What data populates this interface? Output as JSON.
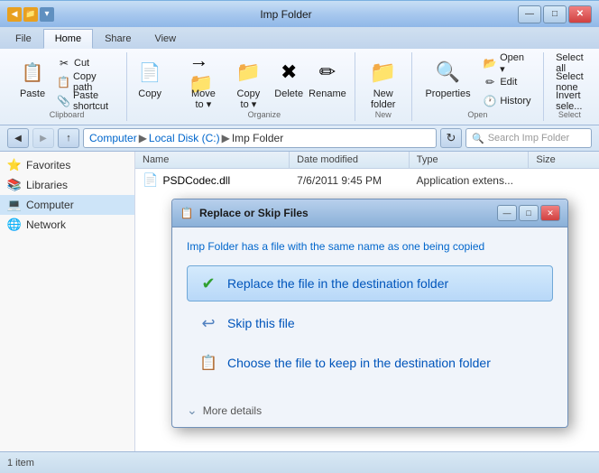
{
  "window": {
    "title": "Imp Folder",
    "controls": {
      "minimize": "—",
      "maximize": "□",
      "close": "✕"
    }
  },
  "ribbon": {
    "tabs": [
      {
        "label": "File",
        "active": false
      },
      {
        "label": "Home",
        "active": true
      },
      {
        "label": "Share",
        "active": false
      },
      {
        "label": "View",
        "active": false
      }
    ],
    "groups": {
      "clipboard": {
        "label": "Clipboard",
        "copy_label": "Copy",
        "paste_label": "Paste",
        "cut_label": "Cut",
        "copy_path_label": "Copy path",
        "paste_shortcut_label": "Paste shortcut"
      },
      "organize": {
        "label": "Organize",
        "move_to_label": "Move to ▾",
        "copy_to_label": "Copy to ▾",
        "delete_label": "Delete",
        "rename_label": "Rename"
      },
      "new": {
        "label": "New",
        "new_folder_label": "New\nfolder"
      },
      "open": {
        "label": "Open",
        "properties_label": "Properties",
        "open_label": "Open ▾",
        "edit_label": "Edit",
        "history_label": "History"
      },
      "select": {
        "label": "Select",
        "select_all_label": "Select all",
        "select_none_label": "Select none",
        "invert_label": "Invert sele..."
      }
    }
  },
  "address_bar": {
    "back_btn": "◀",
    "forward_btn": "▶",
    "up_btn": "↑",
    "path": [
      "Computer",
      "Local Disk (C:)",
      "Imp Folder"
    ],
    "search_placeholder": "Search Imp Folder"
  },
  "nav_pane": {
    "items": [
      {
        "label": "Favorites",
        "icon": "⭐"
      },
      {
        "label": "Libraries",
        "icon": "📚"
      },
      {
        "label": "Computer",
        "icon": "💻",
        "selected": true
      },
      {
        "label": "Network",
        "icon": "🌐"
      }
    ]
  },
  "file_list": {
    "columns": [
      {
        "label": "Name"
      },
      {
        "label": "Date modified"
      },
      {
        "label": "Type"
      },
      {
        "label": "Size"
      }
    ],
    "files": [
      {
        "name": "PSDCodec.dll",
        "icon": "📄",
        "date": "7/6/2011 9:45 PM",
        "type": "Application extens...",
        "size": ""
      }
    ]
  },
  "status_bar": {
    "text": "1 item"
  },
  "dialog": {
    "title": "Replace or Skip Files",
    "icon": "📋",
    "controls": {
      "minimize": "—",
      "maximize": "□",
      "close": "✕"
    },
    "message_before": "Imp Folder",
    "message_after": " has a file with the same name as one being copied",
    "options": [
      {
        "id": "replace",
        "icon": "✔",
        "text": "Replace the file in the destination folder",
        "highlighted": true
      },
      {
        "id": "skip",
        "icon": "↩",
        "text": "Skip this file",
        "highlighted": false
      },
      {
        "id": "keep",
        "icon": "📋",
        "text": "Choose the file to keep in the destination folder",
        "highlighted": false
      }
    ],
    "more_details_label": "More details"
  }
}
